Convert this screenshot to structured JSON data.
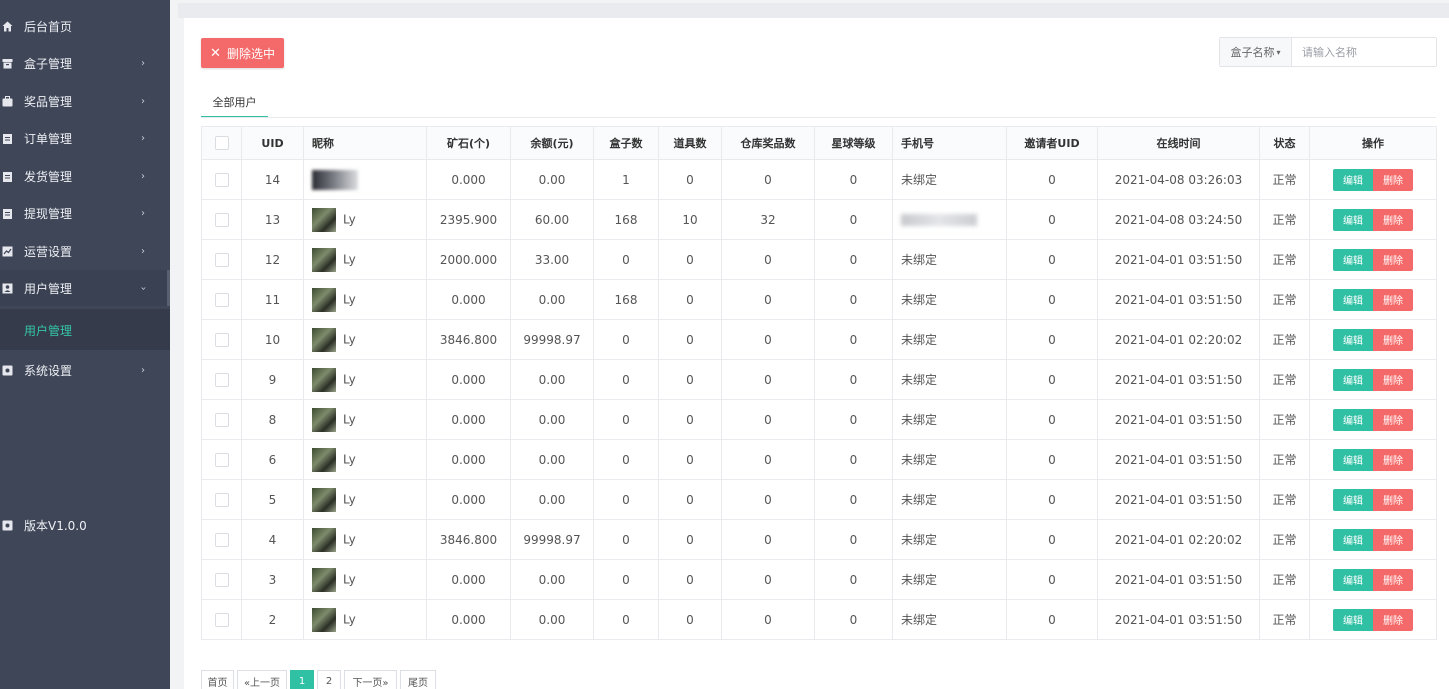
{
  "sidebar": {
    "items": [
      {
        "label": "后台首页",
        "icon": "home-icon"
      },
      {
        "label": "盒子管理",
        "icon": "box-icon"
      },
      {
        "label": "奖品管理",
        "icon": "gift-icon"
      },
      {
        "label": "订单管理",
        "icon": "clipboard-icon"
      },
      {
        "label": "发货管理",
        "icon": "clipboard-icon"
      },
      {
        "label": "提现管理",
        "icon": "clipboard-icon"
      },
      {
        "label": "运营设置",
        "icon": "chart-icon"
      },
      {
        "label": "用户管理",
        "icon": "user-card-icon"
      },
      {
        "label": "系统设置",
        "icon": "settings-icon"
      }
    ],
    "active_sub": "用户管理",
    "version": "版本V1.0.0",
    "accent_color": "#34c6a8"
  },
  "toolbar": {
    "delete_selected_label": "删除选中",
    "search_select_label": "盒子名称",
    "search_placeholder": "请输入名称"
  },
  "tabs": [
    {
      "label": "全部用户"
    }
  ],
  "table": {
    "headers": [
      "UID",
      "昵称",
      "矿石(个)",
      "余额(元)",
      "盒子数",
      "道具数",
      "仓库奖品数",
      "星球等级",
      "手机号",
      "邀请者UID",
      "在线时间",
      "状态",
      "操作"
    ],
    "edit_label": "编辑",
    "delete_label": "删除",
    "rows": [
      {
        "uid": "14",
        "nick": "",
        "ore": "0.000",
        "balance": "0.00",
        "boxes": "1",
        "props": "0",
        "prizes": "0",
        "level": "0",
        "phone": "未绑定",
        "inviter": "0",
        "online": "2021-04-08 03:26:03",
        "status": "正常"
      },
      {
        "uid": "13",
        "nick": "Ly",
        "ore": "2395.900",
        "balance": "60.00",
        "boxes": "168",
        "props": "10",
        "prizes": "32",
        "level": "0",
        "phone": "",
        "inviter": "0",
        "online": "2021-04-08 03:24:50",
        "status": "正常"
      },
      {
        "uid": "12",
        "nick": "Ly",
        "ore": "2000.000",
        "balance": "33.00",
        "boxes": "0",
        "props": "0",
        "prizes": "0",
        "level": "0",
        "phone": "未绑定",
        "inviter": "0",
        "online": "2021-04-01 03:51:50",
        "status": "正常"
      },
      {
        "uid": "11",
        "nick": "Ly",
        "ore": "0.000",
        "balance": "0.00",
        "boxes": "168",
        "props": "0",
        "prizes": "0",
        "level": "0",
        "phone": "未绑定",
        "inviter": "0",
        "online": "2021-04-01 03:51:50",
        "status": "正常"
      },
      {
        "uid": "10",
        "nick": "Ly",
        "ore": "3846.800",
        "balance": "99998.97",
        "boxes": "0",
        "props": "0",
        "prizes": "0",
        "level": "0",
        "phone": "未绑定",
        "inviter": "0",
        "online": "2021-04-01 02:20:02",
        "status": "正常"
      },
      {
        "uid": "9",
        "nick": "Ly",
        "ore": "0.000",
        "balance": "0.00",
        "boxes": "0",
        "props": "0",
        "prizes": "0",
        "level": "0",
        "phone": "未绑定",
        "inviter": "0",
        "online": "2021-04-01 03:51:50",
        "status": "正常"
      },
      {
        "uid": "8",
        "nick": "Ly",
        "ore": "0.000",
        "balance": "0.00",
        "boxes": "0",
        "props": "0",
        "prizes": "0",
        "level": "0",
        "phone": "未绑定",
        "inviter": "0",
        "online": "2021-04-01 03:51:50",
        "status": "正常"
      },
      {
        "uid": "6",
        "nick": "Ly",
        "ore": "0.000",
        "balance": "0.00",
        "boxes": "0",
        "props": "0",
        "prizes": "0",
        "level": "0",
        "phone": "未绑定",
        "inviter": "0",
        "online": "2021-04-01 03:51:50",
        "status": "正常"
      },
      {
        "uid": "5",
        "nick": "Ly",
        "ore": "0.000",
        "balance": "0.00",
        "boxes": "0",
        "props": "0",
        "prizes": "0",
        "level": "0",
        "phone": "未绑定",
        "inviter": "0",
        "online": "2021-04-01 03:51:50",
        "status": "正常"
      },
      {
        "uid": "4",
        "nick": "Ly",
        "ore": "3846.800",
        "balance": "99998.97",
        "boxes": "0",
        "props": "0",
        "prizes": "0",
        "level": "0",
        "phone": "未绑定",
        "inviter": "0",
        "online": "2021-04-01 02:20:02",
        "status": "正常"
      },
      {
        "uid": "3",
        "nick": "Ly",
        "ore": "0.000",
        "balance": "0.00",
        "boxes": "0",
        "props": "0",
        "prizes": "0",
        "level": "0",
        "phone": "未绑定",
        "inviter": "0",
        "online": "2021-04-01 03:51:50",
        "status": "正常"
      },
      {
        "uid": "2",
        "nick": "Ly",
        "ore": "0.000",
        "balance": "0.00",
        "boxes": "0",
        "props": "0",
        "prizes": "0",
        "level": "0",
        "phone": "未绑定",
        "inviter": "0",
        "online": "2021-04-01 03:51:50",
        "status": "正常"
      }
    ]
  },
  "pagination": {
    "first": "首页",
    "prev": "«上一页",
    "pages": [
      "1",
      "2"
    ],
    "current": "1",
    "next": "下一页»",
    "last": "尾页"
  },
  "colors": {
    "primary": "#30c0a4",
    "danger": "#f46a6a",
    "sidebar_bg": "#3f4658"
  }
}
